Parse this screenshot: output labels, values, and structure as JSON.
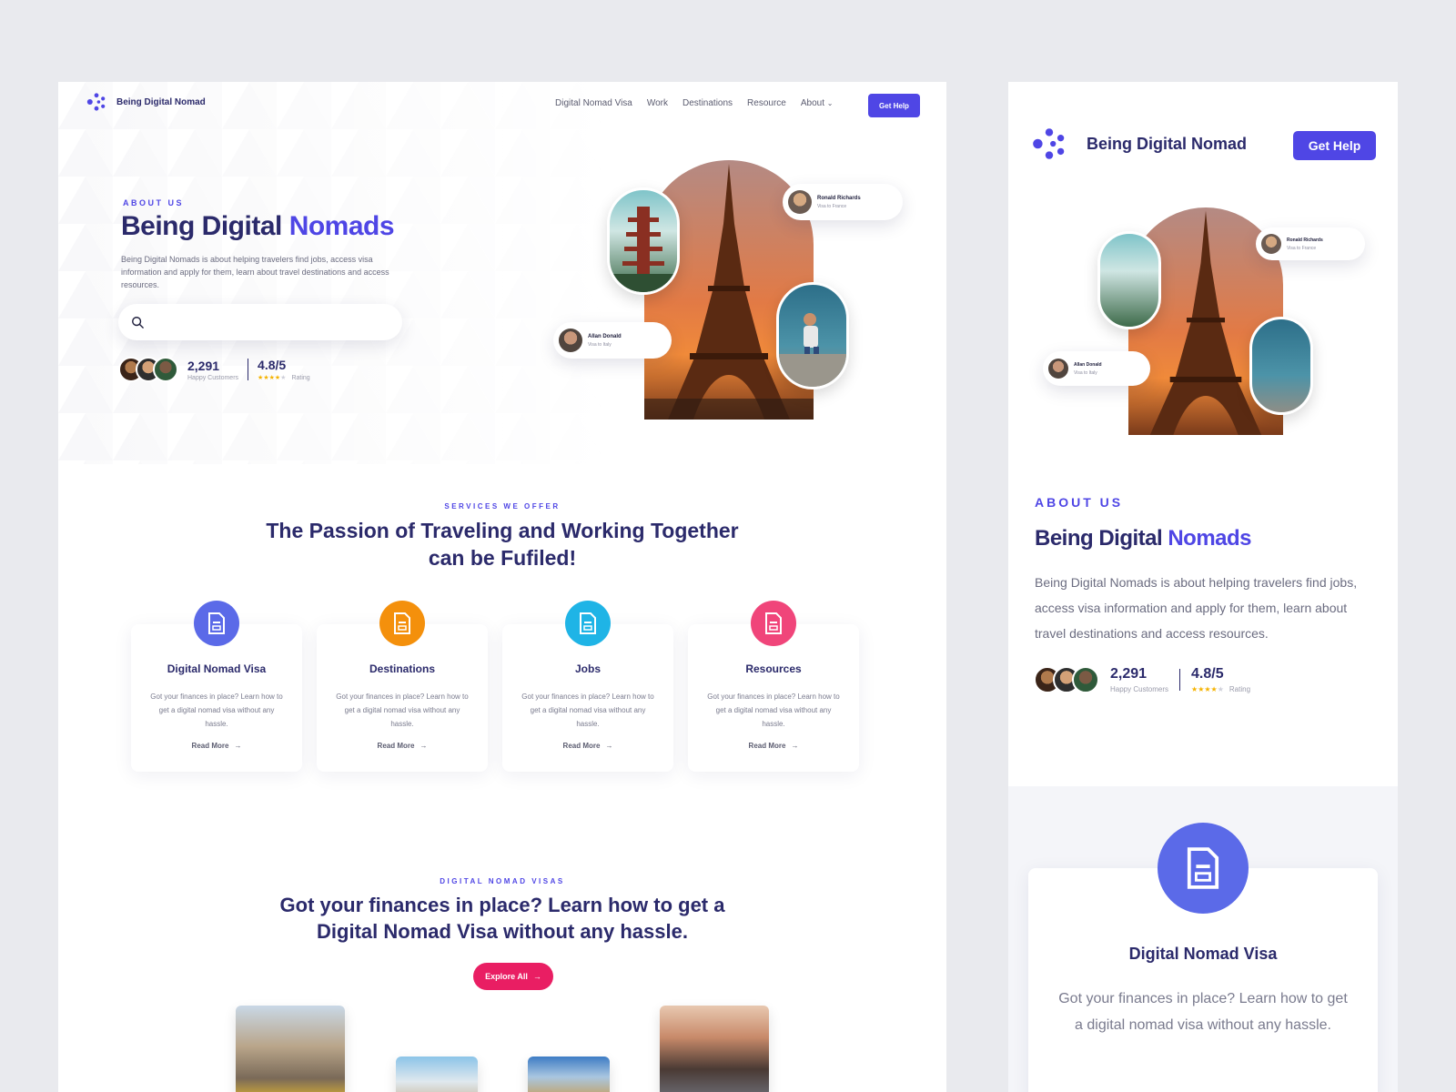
{
  "brand": {
    "name": "Being Digital Nomad"
  },
  "nav": {
    "items": [
      "Digital Nomad Visa",
      "Work",
      "Destinations",
      "Resource",
      "About"
    ],
    "cta": "Get Help"
  },
  "hero": {
    "eyebrow": "ABOUT US",
    "title_main": "Being Digital",
    "title_accent": "Nomads",
    "description": "Being Digital Nomads is about helping travelers find jobs, access visa information and apply for them, learn about travel destinations and access resources.",
    "search_placeholder": "",
    "customers_count": "2,291",
    "customers_label": "Happy Customers",
    "rating_value": "4.8/5",
    "rating_label": "Rating",
    "rating_stars": 4
  },
  "testimonials": [
    {
      "name": "Ronald Richards",
      "visa": "Visa to France"
    },
    {
      "name": "Allan Donald",
      "visa": "Visa to Italy"
    }
  ],
  "services": {
    "eyebrow": "SERVICES WE OFFER",
    "title_line1": "The Passion of Traveling and Working Together",
    "title_line2": "can be Fufiled!",
    "cards": [
      {
        "title": "Digital Nomad Visa",
        "text": "Got your finances in place? Learn how to get a digital nomad visa without any hassle.",
        "link": "Read More",
        "icon": "document-icon",
        "color": "#5b6ae8"
      },
      {
        "title": "Destinations",
        "text": "Got your finances in place? Learn how to get a digital nomad visa without any hassle.",
        "link": "Read More",
        "icon": "document-icon",
        "color": "#f4900c"
      },
      {
        "title": "Jobs",
        "text": "Got your finances in place? Learn how to get a digital nomad visa without any hassle.",
        "link": "Read More",
        "icon": "document-icon",
        "color": "#1fb4e6"
      },
      {
        "title": "Resources",
        "text": "Got your finances in place? Learn how to get a digital nomad visa without any hassle.",
        "link": "Read More",
        "icon": "document-icon",
        "color": "#f0457a"
      }
    ]
  },
  "visas": {
    "eyebrow": "DIGITAL NOMAD VISAS",
    "title_line1": "Got your finances in place? Learn how to get a",
    "title_line2": "Digital Nomad Visa without any hassle.",
    "cta": "Explore All"
  },
  "mobile": {
    "brand": "Being Digital Nomad",
    "cta": "Get Help",
    "eyebrow": "ABOUT US",
    "title_main": "Being Digital",
    "title_accent": "Nomads",
    "description": "Being Digital Nomads is about helping travelers find jobs, access visa information and apply for them, learn about travel destinations and access resources.",
    "customers_count": "2,291",
    "customers_label": "Happy Customers",
    "rating_value": "4.8/5",
    "rating_label": "Rating",
    "card_title": "Digital Nomad Visa",
    "card_text": "Got your finances in place? Learn how to get a digital nomad visa without any hassle."
  },
  "colors": {
    "primary": "#4f46e5",
    "navy": "#2b2a6b",
    "pink": "#e91e63"
  }
}
